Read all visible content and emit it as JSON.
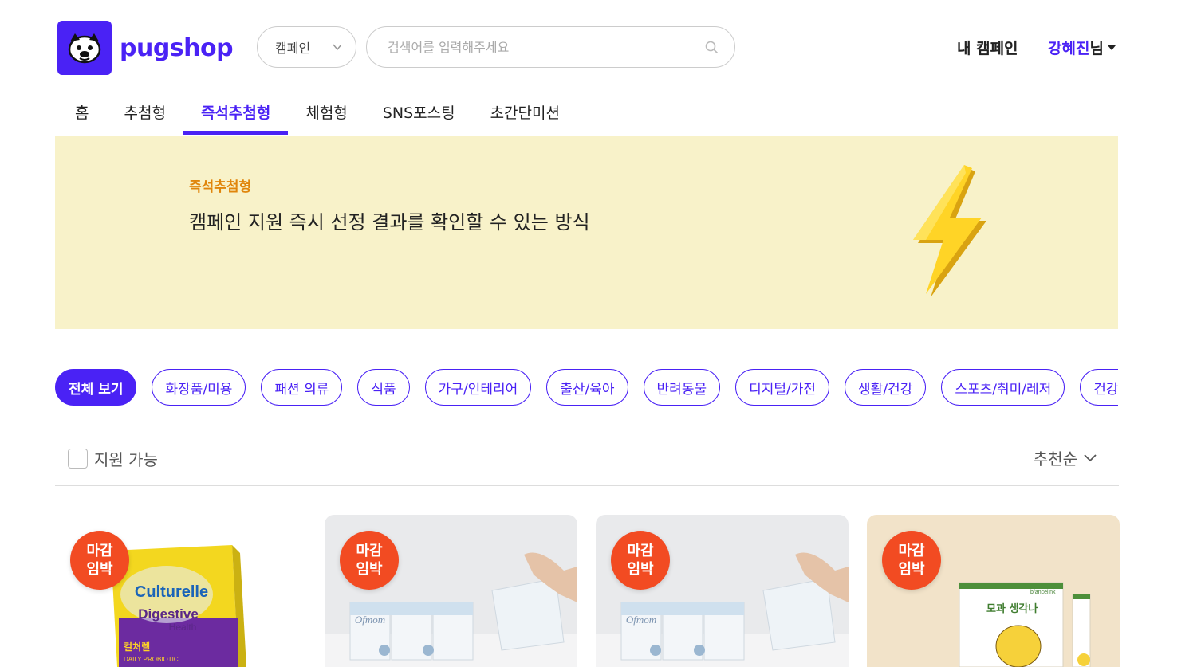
{
  "top_links": [
    "",
    ""
  ],
  "brand": {
    "name": "pugshop",
    "color": "#4a22f5"
  },
  "search": {
    "category": "캠페인",
    "placeholder": "검색어를 입력해주세요"
  },
  "header": {
    "my_campaign": "내 캠페인",
    "user_name": "강혜진",
    "user_suffix": "님"
  },
  "nav": [
    {
      "label": "홈",
      "active": false
    },
    {
      "label": "추첨형",
      "active": false
    },
    {
      "label": "즉석추첨형",
      "active": true
    },
    {
      "label": "체험형",
      "active": false
    },
    {
      "label": "SNS포스팅",
      "active": false
    },
    {
      "label": "초간단미션",
      "active": false
    }
  ],
  "banner": {
    "kicker": "즉석추첨형",
    "title": "캠페인 지원 즉시 선정 결과를 확인할 수 있는 방식",
    "icon": "lightning-bolt-icon",
    "background": "#f8f2c9"
  },
  "filters": [
    {
      "label": "전체 보기",
      "active": true
    },
    {
      "label": "화장품/미용",
      "active": false
    },
    {
      "label": "패션 의류",
      "active": false
    },
    {
      "label": "식품",
      "active": false
    },
    {
      "label": "가구/인테리어",
      "active": false
    },
    {
      "label": "출산/육아",
      "active": false
    },
    {
      "label": "반려동물",
      "active": false
    },
    {
      "label": "디지털/가전",
      "active": false
    },
    {
      "label": "생활/건강",
      "active": false
    },
    {
      "label": "스포츠/취미/레저",
      "active": false
    },
    {
      "label": "건강기",
      "active": false
    }
  ],
  "toolbar": {
    "filter_label": "지원 가능",
    "sort_label": "추천순"
  },
  "cards": [
    {
      "badge_line1": "마감",
      "badge_line2": "임박",
      "product_brand": "Culturelle",
      "product_name": "Digestive",
      "product_sub": "Health",
      "product_kr": "컬처렐",
      "product_en": "DAILY PROBIOTIC"
    },
    {
      "badge_line1": "마감",
      "badge_line2": "임박",
      "product_brand": "Ofmom"
    },
    {
      "badge_line1": "마감",
      "badge_line2": "임박",
      "product_brand": "Ofmom"
    },
    {
      "badge_line1": "마감",
      "badge_line2": "임박",
      "product_name": "모과 생각나",
      "product_brand": "b/ancelink"
    }
  ]
}
